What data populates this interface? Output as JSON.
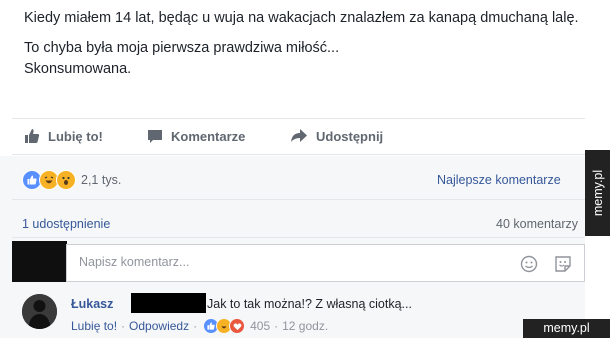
{
  "post": {
    "line1": "Kiedy miałem 14 lat, będąc u wuja na wakacjach znalazłem za kanapą dmuchaną lalę.",
    "line2": "To chyba była moja pierwsza prawdziwa miłość...",
    "line3": "Skonsumowana."
  },
  "actions": {
    "like_label": "Lubię to!",
    "comment_label": "Komentarze",
    "share_label": "Udostępnij"
  },
  "stats": {
    "reaction_icons": [
      "like-icon",
      "laugh-icon",
      "wow-icon"
    ],
    "reactions_count": "2,1 tys.",
    "sort_label": "Najlepsze komentarze",
    "shares": "1 udostępnienie",
    "comments": "40 komentarzy"
  },
  "composer": {
    "placeholder": "Napisz komentarz..."
  },
  "comment": {
    "author": "Łukasz",
    "text": "Jak to tak można!? Z własną ciotką...",
    "like_label": "Lubię to!",
    "reply_label": "Odpowiedz",
    "reaction_count": "405",
    "time": "12 godz."
  },
  "watermark": {
    "side": "memy.pl",
    "bottom": "memy.pl"
  },
  "colors": {
    "link": "#365899",
    "muted": "#606770",
    "like_blue": "#5890ff",
    "haha_yellow": "#f7b125"
  }
}
